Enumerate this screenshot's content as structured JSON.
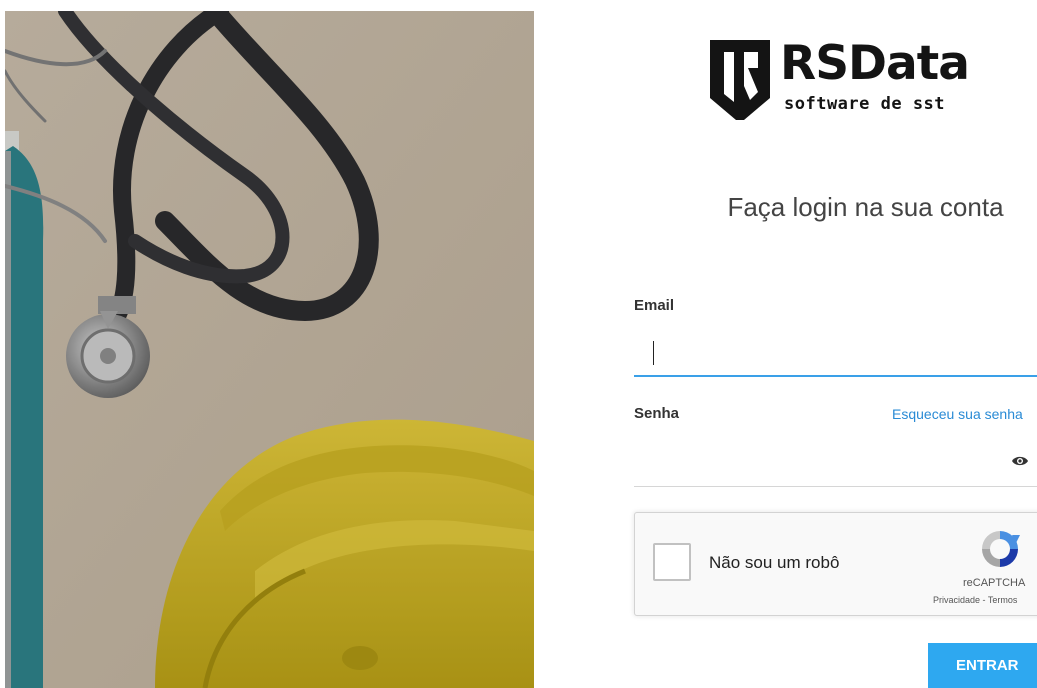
{
  "brand": {
    "name": "RSData",
    "tagline": "software de sst"
  },
  "login": {
    "title": "Faça login na sua conta",
    "email_label": "Email",
    "email_value": "",
    "password_label": "Senha",
    "forgot_link": "Esqueceu sua senha",
    "password_toggle_icon": "eye-icon",
    "submit_label": "ENTRAR"
  },
  "captcha": {
    "label": "Não sou um robô",
    "brand": "reCAPTCHA",
    "terms": "Privacidade - Termos"
  },
  "colors": {
    "accent": "#2ea8f0",
    "link": "#2a8bd5",
    "focus_underline": "#3aa0e8",
    "helmet": "#cdb52a",
    "background_surface": "#c9bcaa"
  },
  "hero_image": {
    "subject_icons": [
      "stethoscope-icon",
      "hard-hat-icon",
      "clipboard-icon"
    ]
  }
}
